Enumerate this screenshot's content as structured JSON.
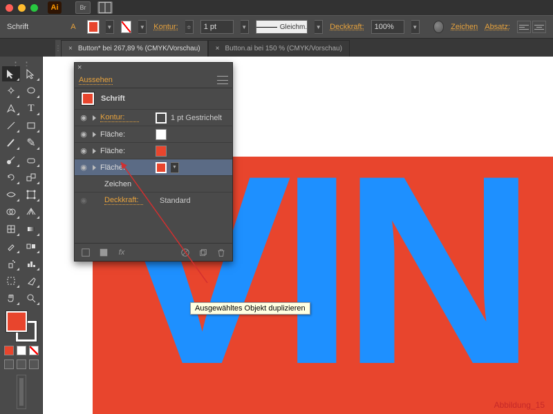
{
  "title_row": {
    "app_abbrev": "Ai",
    "bridge_label": "Br"
  },
  "optbar": {
    "left_label": "Schrift",
    "kontur_label": "Kontur:",
    "stroke_weight": "1 pt",
    "stroke_style": "Gleichm.",
    "opacity_label": "Deckkraft:",
    "opacity_value": "100%",
    "zeichen_link": "Zeichen",
    "absatz_link": "Absatz:"
  },
  "tabs": [
    {
      "label": "Button* bei 267,89 % (CMYK/Vorschau)",
      "active": true
    },
    {
      "label": "Button.ai bei 150 % (CMYK/Vorschau)",
      "active": false
    }
  ],
  "appearance": {
    "tab": "Aussehen",
    "header_type": "Schrift",
    "rows": [
      {
        "kind": "stroke",
        "label": "Kontur:",
        "value": "1 pt Gestrichelt"
      },
      {
        "kind": "fill",
        "label": "Fläche:",
        "swatch": "white"
      },
      {
        "kind": "fill",
        "label": "Fläche:",
        "swatch": "orange"
      },
      {
        "kind": "fill",
        "label": "Fläche:",
        "swatch": "orange",
        "selected": true
      },
      {
        "kind": "char",
        "label": "Zeichen"
      },
      {
        "kind": "opacity",
        "label": "Deckkraft:",
        "value": "Standard"
      }
    ],
    "footer": {
      "fx": "fx"
    }
  },
  "canvas": {
    "big_text": "VIN",
    "caption": "Abbildung_15"
  },
  "tooltip": "Ausgewähltes Objekt duplizieren"
}
